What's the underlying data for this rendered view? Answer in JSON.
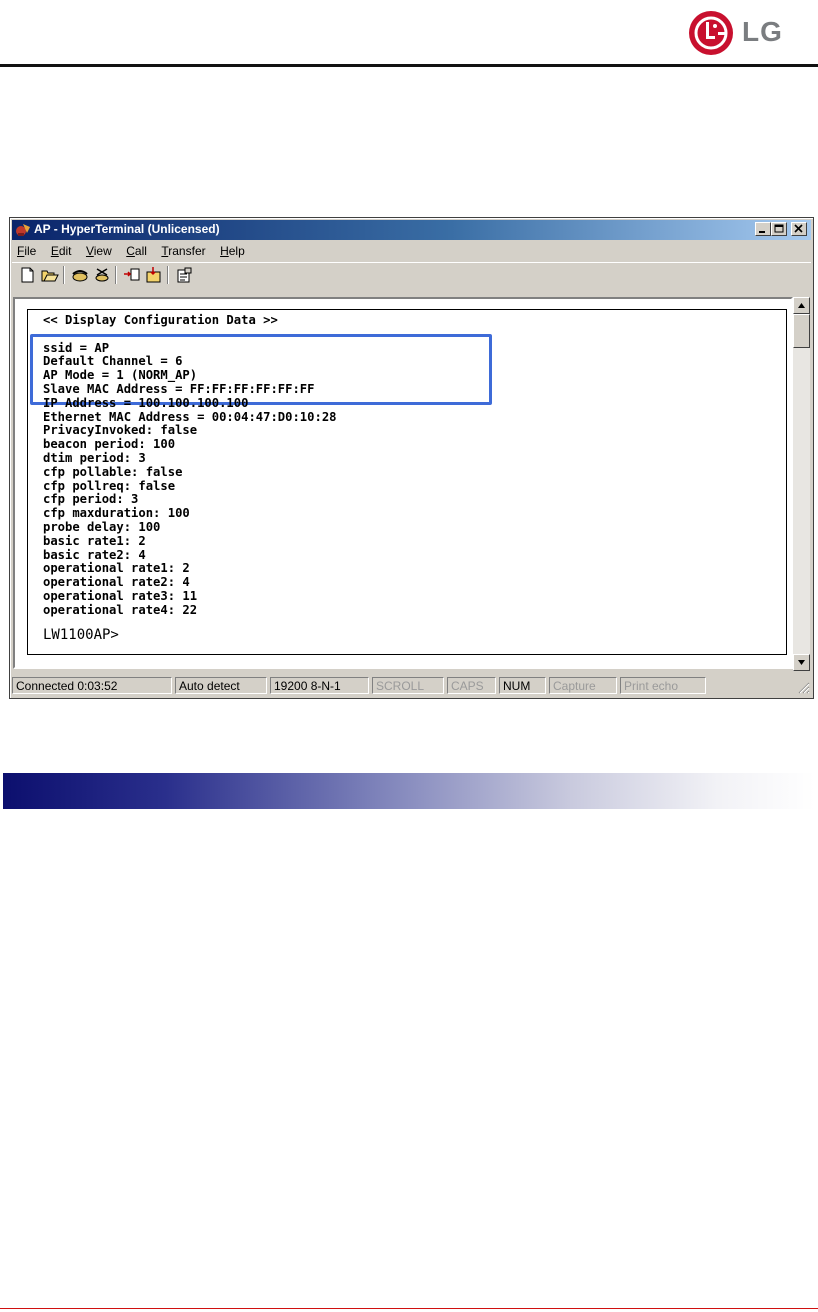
{
  "brand": {
    "logo_text": "LG",
    "logo_color": "#c8102e"
  },
  "window": {
    "title": "AP - HyperTerminal (Unlicensed)",
    "menu": [
      "File",
      "Edit",
      "View",
      "Call",
      "Transfer",
      "Help"
    ],
    "toolbar_icons": [
      "new-icon",
      "open-icon",
      "dial-icon",
      "disconnect-icon",
      "send-icon",
      "receive-icon",
      "properties-icon"
    ]
  },
  "terminal": {
    "header": "<< Display Configuration Data >>",
    "lines": [
      "ssid = AP",
      "Default Channel = 6",
      "AP Mode = 1 (NORM_AP)",
      "Slave MAC Address = FF:FF:FF:FF:FF:FF",
      "IP Address = 100.100.100.100",
      "Ethernet MAC Address = 00:04:47:D0:10:28",
      "PrivacyInvoked: false",
      "beacon period: 100",
      "dtim period: 3",
      "cfp pollable: false",
      "cfp pollreq: false",
      "cfp period: 3",
      "cfp maxduration: 100",
      "probe delay: 100",
      "basic rate1: 2",
      "basic rate2: 4",
      "operational rate1: 2",
      "operational rate2: 4",
      "operational rate3: 11",
      "operational rate4: 22"
    ],
    "prompt": "LW1100AP>",
    "highlight_color": "#3e6bd8"
  },
  "status": {
    "connected": "Connected 0:03:52",
    "detect": "Auto detect",
    "settings": "19200 8-N-1",
    "scroll": "SCROLL",
    "caps": "CAPS",
    "num": "NUM",
    "capture": "Capture",
    "print_echo": "Print echo"
  }
}
